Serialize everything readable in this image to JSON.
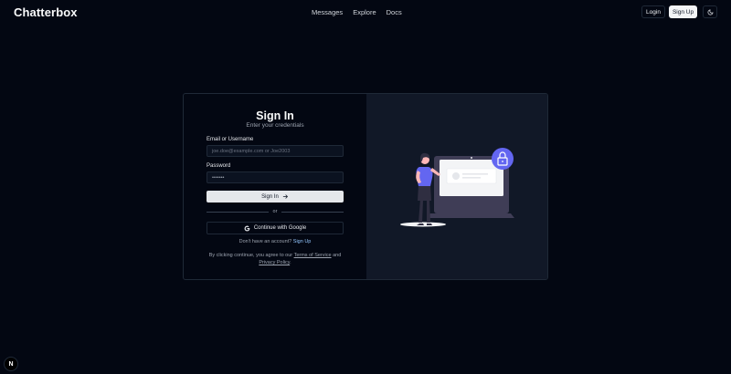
{
  "header": {
    "brand": "Chatterbox",
    "nav": [
      "Messages",
      "Explore",
      "Docs"
    ],
    "login_label": "Login",
    "signup_label": "Sign Up",
    "theme_icon": "moon-icon"
  },
  "signin": {
    "title": "Sign In",
    "subtitle": "Enter your credentials",
    "email_label": "Email or Username",
    "email_placeholder": "joe.doe@example.com or Joe2003",
    "password_label": "Password",
    "password_value": "•••••••",
    "submit_label": "Sign In",
    "divider_text": "or",
    "google_label": "Continue with Google",
    "no_account_text": "Don't have an account?",
    "signup_link": "Sign Up",
    "terms_prefix": "By clicking continue, you agree to our",
    "terms_link": "Terms of Service",
    "terms_and": "and",
    "privacy_link": "Privacy Policy",
    "terms_suffix": "."
  },
  "badge": {
    "label": "N"
  },
  "colors": {
    "background": "#030712",
    "panel": "#111827",
    "accent": "#6366f1",
    "link": "#93c5fd"
  }
}
